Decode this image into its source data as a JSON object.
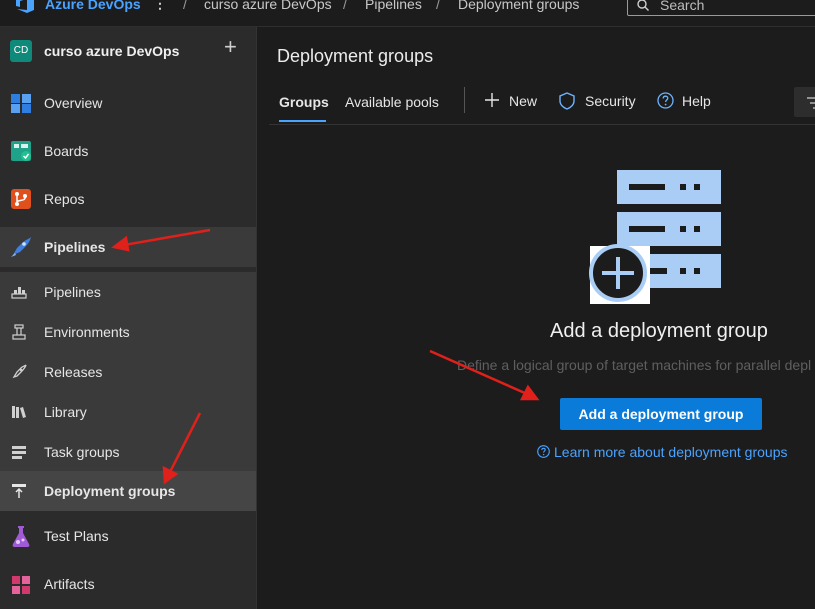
{
  "topbar": {
    "brand": "Azure DevOps",
    "more_glyph": "⋮",
    "breadcrumbs": [
      "curso azure DevOps",
      "Pipelines",
      "Deployment groups"
    ],
    "separator": "/",
    "search_placeholder": "Search",
    "logo_icon": "azure-devops-logo"
  },
  "sidebar": {
    "project_initials": "CD",
    "project_name": "curso azure DevOps",
    "add_glyph": "+",
    "items": [
      {
        "label": "Overview",
        "icon": "overview-icon"
      },
      {
        "label": "Boards",
        "icon": "boards-icon"
      },
      {
        "label": "Repos",
        "icon": "repos-icon"
      },
      {
        "label": "Pipelines",
        "icon": "pipelines-icon"
      },
      {
        "label": "Pipelines",
        "icon": "pipelines-sub-icon"
      },
      {
        "label": "Environments",
        "icon": "environments-icon"
      },
      {
        "label": "Releases",
        "icon": "releases-icon"
      },
      {
        "label": "Library",
        "icon": "library-icon"
      },
      {
        "label": "Task groups",
        "icon": "task-groups-icon"
      },
      {
        "label": "Deployment groups",
        "icon": "deployment-groups-icon"
      },
      {
        "label": "Test Plans",
        "icon": "test-plans-icon"
      },
      {
        "label": "Artifacts",
        "icon": "artifacts-icon"
      }
    ]
  },
  "main": {
    "title": "Deployment groups",
    "tabs": [
      "Groups",
      "Available pools"
    ],
    "toolbar": {
      "new": "New",
      "security": "Security",
      "help": "Help"
    },
    "empty_state": {
      "title": "Add a deployment group",
      "description": "Define a logical group of target machines for parallel depl",
      "button": "Add a deployment group",
      "link": "Learn more about deployment groups"
    }
  },
  "colors": {
    "accent": "#0a7bd8",
    "link": "#4aa3ff",
    "annotation": "#e0201b",
    "illustration": "#a9cdf5"
  }
}
